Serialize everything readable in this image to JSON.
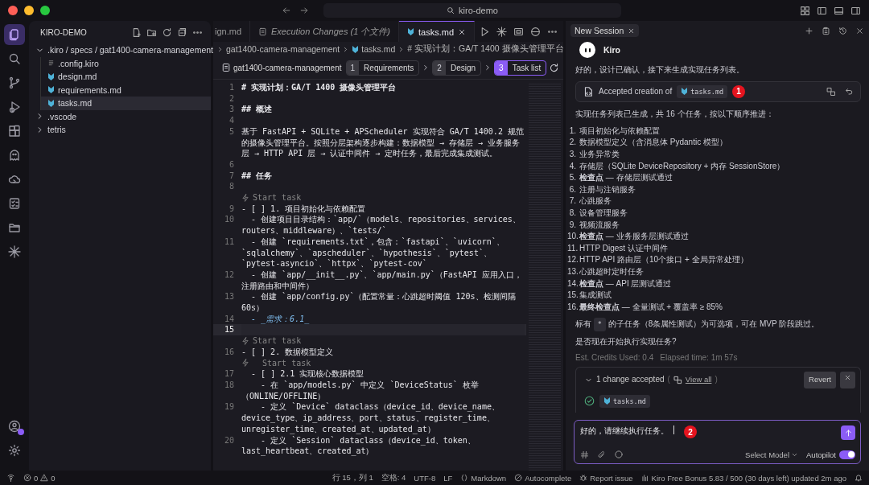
{
  "title_bar": {
    "search": "kiro-demo"
  },
  "activity_bar": {
    "items": [
      {
        "kind": "files",
        "selected": true
      },
      {
        "kind": "search",
        "selected": false
      },
      {
        "kind": "branch",
        "selected": false
      },
      {
        "kind": "debug",
        "selected": false
      },
      {
        "kind": "extensions",
        "selected": false
      },
      {
        "kind": "ghost",
        "selected": false
      },
      {
        "kind": "cloud",
        "selected": false
      },
      {
        "kind": "checklist",
        "selected": false
      },
      {
        "kind": "folder",
        "selected": false
      },
      {
        "kind": "sparkle",
        "selected": false
      }
    ],
    "bottom": [
      {
        "kind": "account"
      },
      {
        "kind": "settings"
      }
    ]
  },
  "explorer": {
    "title": "KIRO-DEMO",
    "tree": [
      {
        "label": ".kiro / specs / gat1400-camera-management",
        "kind": "folder",
        "expanded": true,
        "selected": false,
        "children": [
          {
            "label": ".config.kiro",
            "kind": "config",
            "selected": false
          },
          {
            "label": "design.md",
            "kind": "markdown",
            "selected": false
          },
          {
            "label": "requirements.md",
            "kind": "markdown",
            "selected": false
          },
          {
            "label": "tasks.md",
            "kind": "markdown",
            "selected": true
          }
        ]
      },
      {
        "label": ".vscode",
        "kind": "folder",
        "expanded": false,
        "selected": false
      },
      {
        "label": "tetris",
        "kind": "folder",
        "expanded": false,
        "selected": false
      }
    ]
  },
  "editor": {
    "tabs": [
      {
        "label": "ign.md",
        "selected": false,
        "preview": false
      },
      {
        "label": "Execution Changes (1 个文件)",
        "selected": false,
        "preview": true
      },
      {
        "label": "tasks.md",
        "selected": true,
        "preview": false
      }
    ],
    "breadcrumbs": [
      "gat1400-camera-management",
      "tasks.md",
      "# 实现计划：GA/T 1400 摄像头管理平台"
    ],
    "spec": {
      "name": "gat1400-camera-management",
      "steps": [
        {
          "number": "1",
          "label": "Requirements",
          "selected": false
        },
        {
          "number": "2",
          "label": "Design",
          "selected": false
        },
        {
          "number": "3",
          "label": "Task list",
          "selected": true
        }
      ]
    },
    "lines": [
      {
        "number": "1",
        "kind": "heading",
        "text": "# 实现计划：GA/T 1400 摄像头管理平台",
        "current": false
      },
      {
        "number": "2",
        "kind": "code",
        "current": false
      },
      {
        "number": "3",
        "kind": "heading",
        "text": "## 概述",
        "current": false
      },
      {
        "number": "4",
        "kind": "code",
        "current": false
      },
      {
        "number": "5",
        "kind": "code",
        "text": "基于 FastAPI + SQLite + APScheduler 实现符合 GA/T 1400.2 规范的摄像头管理平台。按照分层架构逐步构建：数据模型 → 存储层 → 业务服务层 → HTTP API 层 → 认证中间件 → 定时任务，最后完成集成测试。",
        "current": false
      },
      {
        "number": "6",
        "kind": "code",
        "current": false
      },
      {
        "number": "7",
        "kind": "heading",
        "text": "## 任务",
        "current": false
      },
      {
        "number": "8",
        "kind": "code",
        "current": false
      },
      {
        "kind": "lens",
        "text": "Start task"
      },
      {
        "number": "9",
        "kind": "code",
        "text": "- [ ] 1. 项目初始化与依赖配置",
        "current": false
      },
      {
        "number": "10",
        "kind": "code",
        "text": "  - 创建项目目录结构：`app/`（models、repositories、services、routers、middleware）、`tests/`",
        "current": false
      },
      {
        "number": "11",
        "kind": "code",
        "text": "  - 创建 `requirements.txt`，包含：`fastapi`、`uvicorn`、`sqlalchemy`、`apscheduler`、`hypothesis`、`pytest`、`pytest-asyncio`、`httpx`、`pytest-cov`",
        "current": false
      },
      {
        "number": "12",
        "kind": "code",
        "text": "  - 创建 `app/__init__.py`、`app/main.py`（FastAPI 应用入口，注册路由和中间件）",
        "current": false
      },
      {
        "number": "13",
        "kind": "code",
        "text": "  - 创建 `app/config.py`（配置常量：心跳超时阈值 120s、检测间隔 60s）",
        "current": false
      },
      {
        "number": "14",
        "kind": "emphasis",
        "text": "  - _需求：6.1_",
        "current": false
      },
      {
        "number": "15",
        "kind": "code",
        "current": true
      },
      {
        "kind": "lens",
        "text": "Start task"
      },
      {
        "number": "16",
        "kind": "code",
        "text": "- [ ] 2. 数据模型定义",
        "current": false
      },
      {
        "kind": "lens",
        "text": "  Start task"
      },
      {
        "number": "17",
        "kind": "code",
        "text": "  - [ ] 2.1 实现核心数据模型",
        "current": false
      },
      {
        "number": "18",
        "kind": "code",
        "text": "    - 在 `app/models.py` 中定义 `DeviceStatus` 枚举（ONLINE/OFFLINE）",
        "current": false
      },
      {
        "number": "19",
        "kind": "code",
        "text": "    - 定义 `Device` dataclass（device_id、device_name、device_type、ip_address、port、status、register_time、unregister_time、created_at、updated_at）",
        "current": false
      },
      {
        "number": "20",
        "kind": "code",
        "text": "    - 定义 `Session` dataclass（device_id、token、last_heartbeat、created_at）",
        "current": false
      }
    ]
  },
  "chat": {
    "tab": "New Session",
    "agent": "Kiro",
    "intro": "好的，设计已确认，接下来生成实现任务列表。",
    "accepted": {
      "text": "Accepted creation of",
      "file": "tasks.md",
      "badge": "1"
    },
    "summary": "实现任务列表已生成，共 16 个任务，按以下顺序推进：",
    "tasks": [
      {
        "number": "1.",
        "text": "项目初始化与依赖配置"
      },
      {
        "number": "2.",
        "text": "数据模型定义（含消息体 Pydantic 模型）"
      },
      {
        "number": "3.",
        "text": "业务异常类"
      },
      {
        "number": "4.",
        "text": "存储层（SQLite DeviceRepository + 内存 SessionStore）"
      },
      {
        "number": "5.",
        "text": "**检查点** — 存储层测试通过"
      },
      {
        "number": "6.",
        "text": "注册与注销服务"
      },
      {
        "number": "7.",
        "text": "心跳服务"
      },
      {
        "number": "8.",
        "text": "设备管理服务"
      },
      {
        "number": "9.",
        "text": "视频流服务"
      },
      {
        "number": "10.",
        "text": "**检查点** — 业务服务层测试通过"
      },
      {
        "number": "11.",
        "text": "HTTP Digest 认证中间件"
      },
      {
        "number": "12.",
        "text": "HTTP API 路由层（10个接口 + 全局异常处理）"
      },
      {
        "number": "13.",
        "text": "心跳超时定时任务"
      },
      {
        "number": "14.",
        "text": "**检查点** — API 层测试通过"
      },
      {
        "number": "15.",
        "text": "集成测试"
      },
      {
        "number": "16.",
        "text": "**最终检查点** — 全量测试 + 覆盖率 ≥ 85%"
      }
    ],
    "note": {
      "before": "标有",
      "code": "*",
      "after": "的子任务（8条属性测试）为可选项，可在 MVP 阶段跳过。"
    },
    "question": "是否现在开始执行实现任务?",
    "credits": "Est. Credits Used: 0.4",
    "elapsed": "Elapsed time: 1m 57s",
    "changes": {
      "expanded": true,
      "summary": "1 change accepted",
      "open": "(",
      "link": "View all",
      "close": ")",
      "revert": "Revert",
      "files": [
        "tasks.md"
      ]
    },
    "input": {
      "value": "好的，请继续执行任务。",
      "badge": "2",
      "model": "Select Model",
      "autopilot": {
        "label": "Autopilot",
        "on": true
      }
    }
  },
  "status_bar": {
    "errors": "0",
    "warnings": "0",
    "position": "行 15，列 1",
    "spaces": "空格: 4",
    "encoding": "UTF-8",
    "eol": "LF",
    "language": "Markdown",
    "autocomplete": "Autocomplete",
    "report": "Report issue",
    "bonus": "Kiro Free Bonus 5.83 / 500 (30 days left) updated 2m ago"
  }
}
